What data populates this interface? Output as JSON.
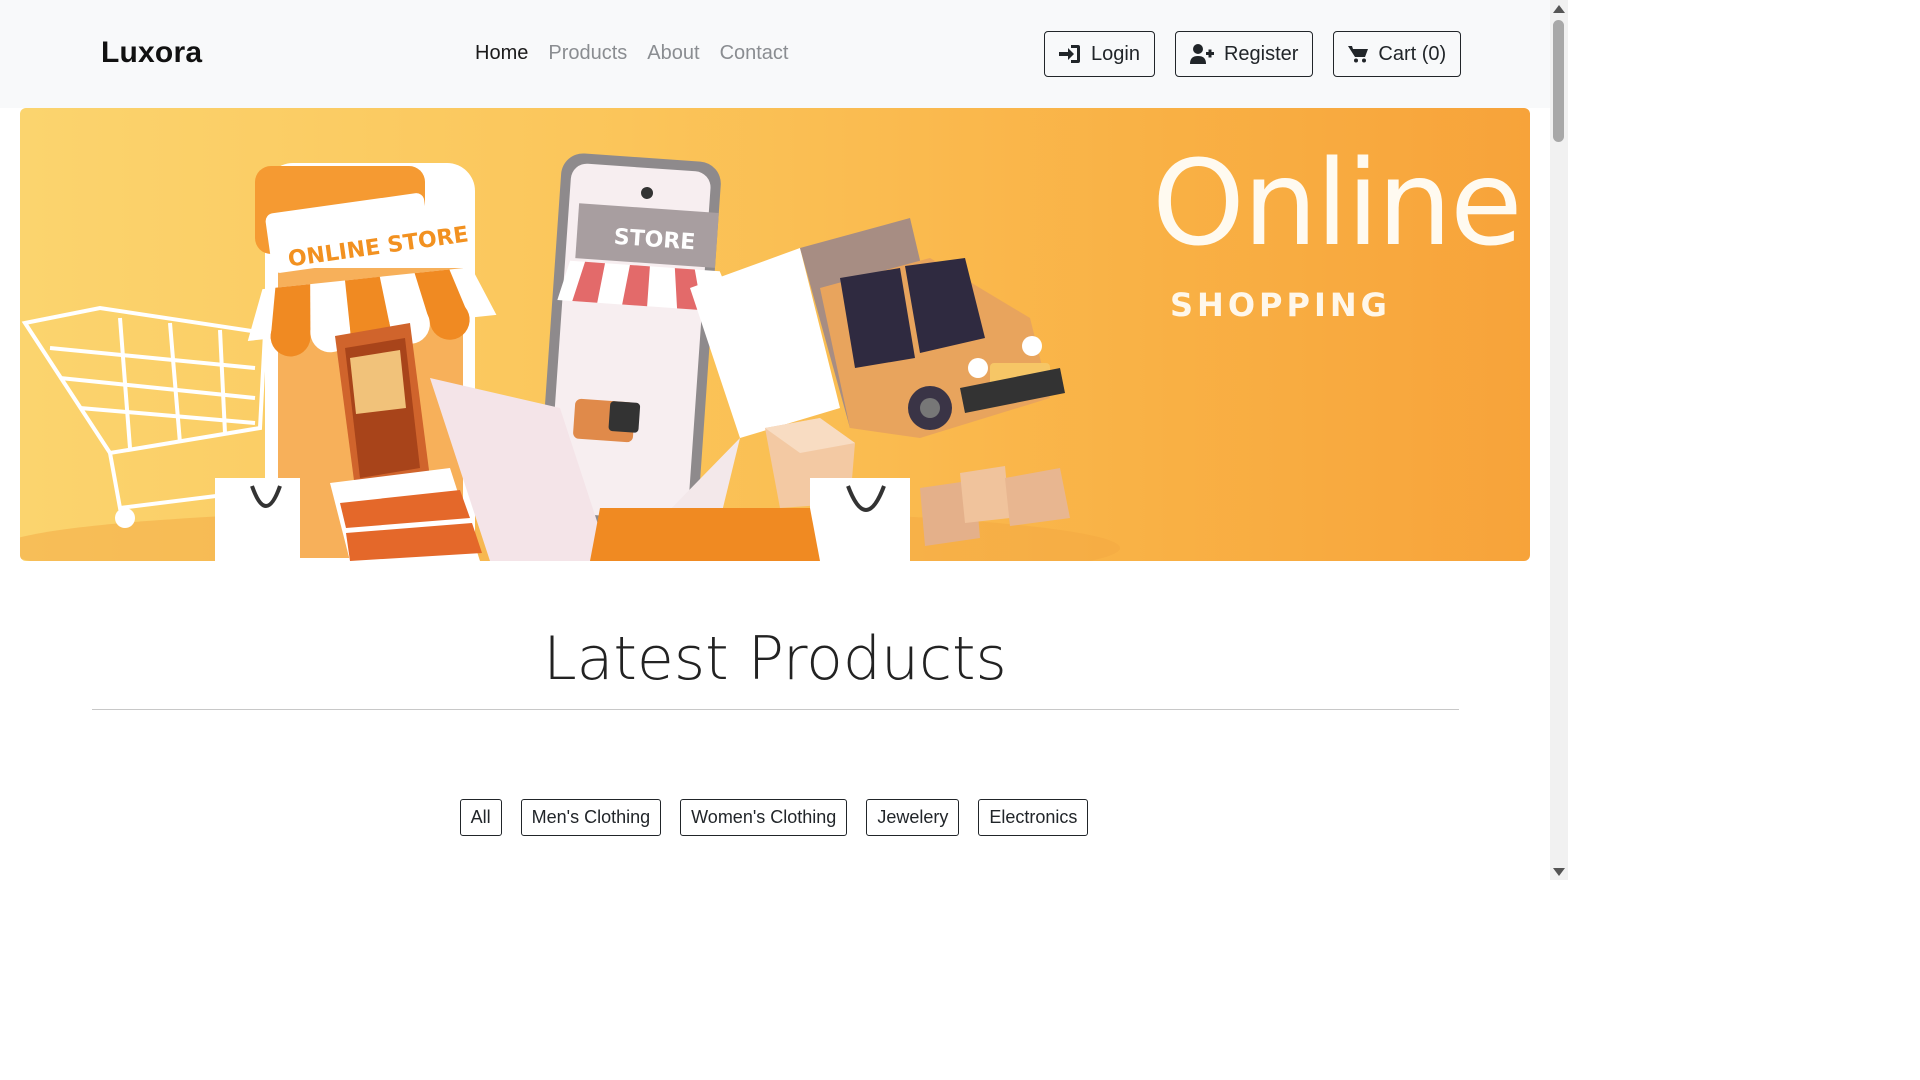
{
  "navbar": {
    "brand": "Luxora",
    "links": [
      {
        "label": "Home",
        "active": true
      },
      {
        "label": "Products",
        "active": false
      },
      {
        "label": "About",
        "active": false
      },
      {
        "label": "Contact",
        "active": false
      }
    ],
    "buttons": {
      "login": "Login",
      "register": "Register",
      "cart": "Cart (0)"
    }
  },
  "hero": {
    "title": "Online.",
    "subtitle": "SHOPPING",
    "store_sign": "ONLINE STORE",
    "phone_sign": "STORE"
  },
  "section": {
    "title": "Latest Products"
  },
  "filters": [
    "All",
    "Men's Clothing",
    "Women's Clothing",
    "Jewelery",
    "Electronics"
  ],
  "colors": {
    "navbar_bg": "#f8f9fa",
    "hero_accent": "#f7a33a",
    "text": "#212529"
  }
}
